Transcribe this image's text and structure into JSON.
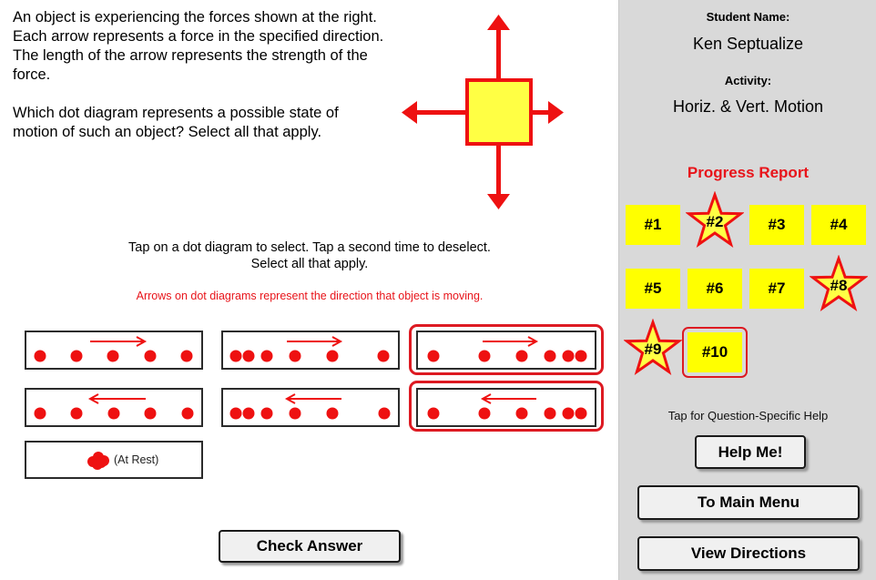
{
  "question": {
    "paragraph1": "An object is experiencing the forces shown at the right. Each arrow represents a force in the specified direction. The length of the arrow represents the strength of the force.",
    "paragraph2": "Which dot diagram represents a possible state of motion of such an object? Select all that apply."
  },
  "force_diagram": {
    "forces": [
      {
        "direction": "up",
        "relative_strength": "long"
      },
      {
        "direction": "down",
        "relative_strength": "long"
      },
      {
        "direction": "left",
        "relative_strength": "long"
      },
      {
        "direction": "right",
        "relative_strength": "short"
      }
    ],
    "object_color": "#ffff44",
    "arrow_color": "#ee1111"
  },
  "instructions": {
    "line1": "Tap on a dot diagram to select. Tap a second time to deselect.",
    "line2": "Select all that apply.",
    "arrow_note": "Arrows on dot diagrams represent the direction that object is moving."
  },
  "dot_diagrams": [
    {
      "id": "A",
      "direction": "right",
      "pattern": "constant-speed",
      "selected": false
    },
    {
      "id": "B",
      "direction": "right",
      "pattern": "speeding-up",
      "selected": false
    },
    {
      "id": "C",
      "direction": "right",
      "pattern": "slowing-down",
      "selected": true
    },
    {
      "id": "D",
      "direction": "left",
      "pattern": "constant-speed",
      "selected": false
    },
    {
      "id": "E",
      "direction": "left",
      "pattern": "slowing-down",
      "selected": false
    },
    {
      "id": "F",
      "direction": "left",
      "pattern": "speeding-up",
      "selected": true
    },
    {
      "id": "G",
      "direction": "none",
      "pattern": "at-rest",
      "label": "(At Rest)",
      "selected": false
    }
  ],
  "check_answer_label": "Check Answer",
  "sidebar": {
    "student_name_label": "Student Name:",
    "student_name": "Ken Septualize",
    "activity_label": "Activity:",
    "activity": "Horiz. & Vert. Motion",
    "progress_title": "Progress Report",
    "questions": [
      {
        "label": "#1",
        "status": "incomplete"
      },
      {
        "label": "#2",
        "status": "star"
      },
      {
        "label": "#3",
        "status": "incomplete"
      },
      {
        "label": "#4",
        "status": "incomplete"
      },
      {
        "label": "#5",
        "status": "incomplete"
      },
      {
        "label": "#6",
        "status": "incomplete"
      },
      {
        "label": "#7",
        "status": "incomplete"
      },
      {
        "label": "#8",
        "status": "star"
      },
      {
        "label": "#9",
        "status": "star"
      },
      {
        "label": "#10",
        "status": "current"
      }
    ],
    "help_note": "Tap for Question-Specific Help",
    "help_button": "Help Me!",
    "main_menu_button": "To Main Menu",
    "directions_button": "View Directions"
  },
  "colors": {
    "accent_red": "#e8141a",
    "tile_yellow": "#ffff00",
    "sidebar_bg": "#d9d9d9"
  }
}
